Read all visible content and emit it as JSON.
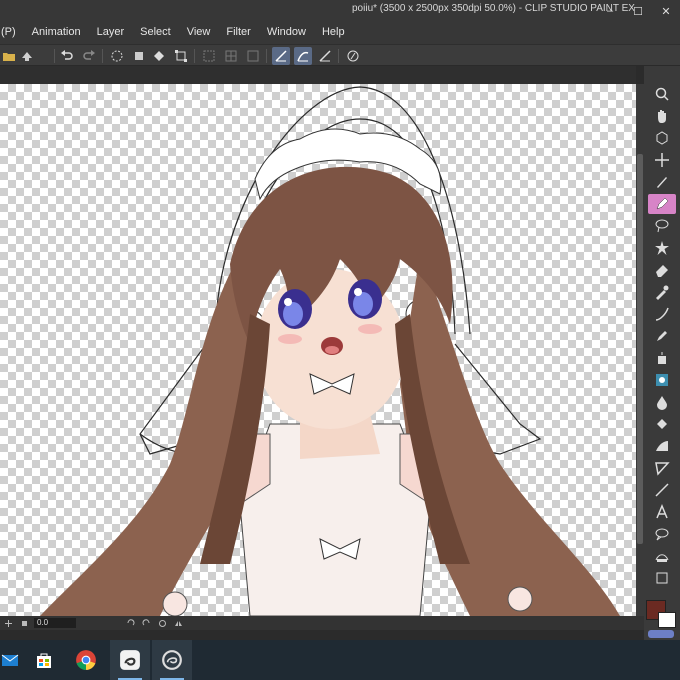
{
  "window": {
    "title": "poiiu* (3500 x 2500px 350dpi 50.0%)  - CLIP STUDIO PAINT EX",
    "controls": [
      "–",
      "☐",
      "✕"
    ]
  },
  "menu": [
    "(P)",
    "Animation",
    "Layer",
    "Select",
    "View",
    "Filter",
    "Window",
    "Help"
  ],
  "command_bar": {
    "icons": [
      "open-folder-icon",
      "save-icon",
      "undo-icon",
      "redo-icon",
      "selection-loading-icon",
      "fill-icon",
      "transform-icon",
      "grid-icon",
      "ruler-snap-icon",
      "active-snap-icon",
      "line-snap-icon",
      "special-ruler-icon"
    ]
  },
  "tools": [
    "zoom-tool",
    "hand-tool",
    "rotate-tool",
    "move-layer-tool",
    "operation-tool",
    "pen-tool",
    "lasso-tool",
    "auto-select-tool",
    "eraser-tool",
    "eyedropper-tool",
    "blend-tool",
    "marker-tool",
    "airbrush-tool",
    "decoration-tool",
    "water-drop-tool",
    "fill-tool",
    "gradient-tool",
    "figure-tool",
    "line-tool",
    "text-tool",
    "balloon-tool",
    "frame-tool",
    "ruler-tool"
  ],
  "active_tool": "pen-tool",
  "colors": {
    "main": "#6b2a22",
    "sub": "#ffffff",
    "accent": "#d784c7"
  },
  "status": {
    "zoom_value": "0.0"
  },
  "taskbar": {
    "apps": [
      "mail-icon",
      "store-icon",
      "chrome-icon",
      "clip-studio-icon",
      "clip-studio-paint-icon"
    ]
  }
}
